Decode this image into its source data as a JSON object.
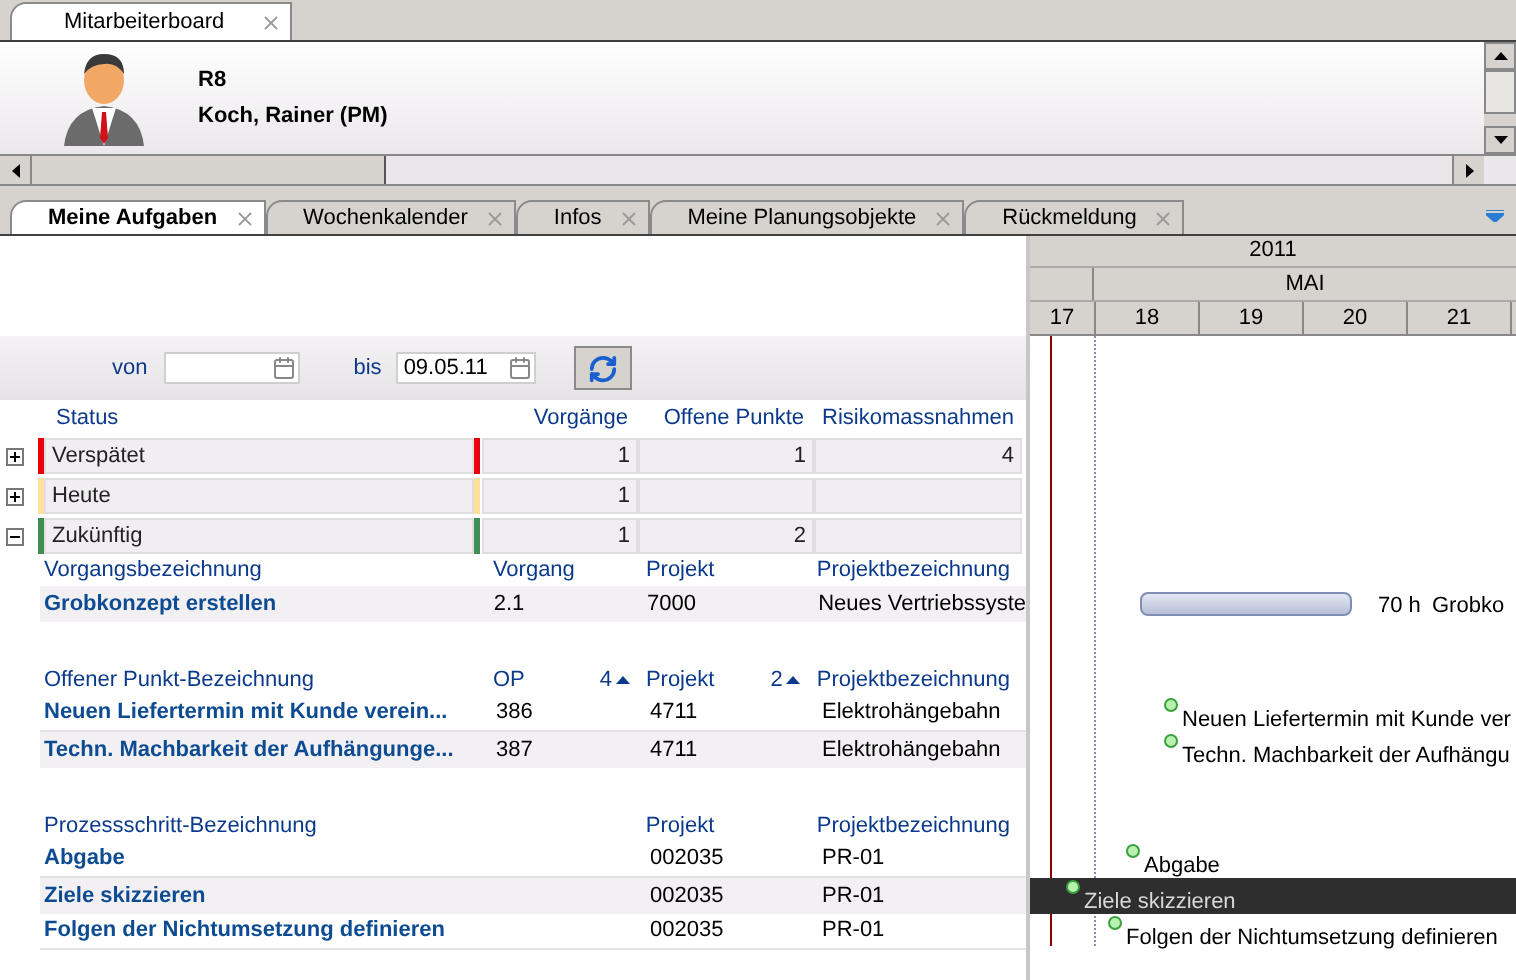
{
  "window_tab": {
    "label": "Mitarbeiterboard"
  },
  "header": {
    "code": "R8",
    "name": "Koch, Rainer (PM)"
  },
  "tabs": [
    {
      "label": "Meine Aufgaben",
      "selected": true
    },
    {
      "label": "Wochenkalender",
      "selected": false
    },
    {
      "label": "Infos",
      "selected": false
    },
    {
      "label": "Meine Planungsobjekte",
      "selected": false
    },
    {
      "label": "Rückmeldung",
      "selected": false
    }
  ],
  "filter": {
    "from_label": "von",
    "to_label": "bis",
    "to_value": "09.05.11"
  },
  "status_table": {
    "columns": [
      "Status",
      "Vorgänge",
      "Offene Punkte",
      "Risikomassnahmen"
    ],
    "rows": [
      {
        "label": "Verspätet",
        "color": "#e8000b",
        "expanded": false,
        "vorgaenge": "1",
        "offene_punkte": "1",
        "risikomassnahmen": "4"
      },
      {
        "label": "Heute",
        "color": "#fbe19a",
        "expanded": false,
        "vorgaenge": "1"
      },
      {
        "label": "Zukünftig",
        "color": "#3f8f54",
        "expanded": true,
        "vorgaenge": "1",
        "offene_punkte": "2"
      }
    ]
  },
  "tasks": {
    "columns": [
      {
        "kind": "name",
        "label": "Vorgangsbezeichnung"
      },
      {
        "kind": "number",
        "label": "Vorgang"
      },
      {
        "kind": "project",
        "label": "Projekt"
      },
      {
        "kind": "project_name",
        "label": "Projektbezeichnung"
      }
    ],
    "rows": [
      {
        "cells": [
          "Grobkonzept erstellen",
          "2.1",
          "7000",
          "Neues Vertriebssyste"
        ],
        "timeline": {
          "kind": "bar",
          "duration": "70 h",
          "label": "Grobko",
          "selected": false
        }
      }
    ]
  },
  "open_points": {
    "columns": [
      {
        "kind": "name",
        "label": "Offener Punkt-Bezeichnung"
      },
      {
        "kind": "number",
        "label": "OP",
        "sort_rank": "4",
        "sort_ascending": true
      },
      {
        "kind": "project",
        "label": "Projekt",
        "sort_rank": "2",
        "sort_ascending": true
      },
      {
        "kind": "project_name",
        "label": "Projektbezeichnung"
      }
    ],
    "rows": [
      {
        "cells": [
          "Neuen Liefertermin mit Kunde verein...",
          "386",
          "4711",
          "Elektrohängebahn"
        ],
        "timeline": {
          "kind": "milestone",
          "label": "Neuen Liefertermin mit Kunde ver",
          "selected": false
        }
      },
      {
        "cells": [
          "Techn. Machbarkeit der Aufhängunge...",
          "387",
          "4711",
          "Elektrohängebahn"
        ],
        "timeline": {
          "kind": "milestone",
          "label": "Techn. Machbarkeit der Aufhängu",
          "selected": false
        }
      }
    ]
  },
  "process_steps": {
    "columns": [
      {
        "kind": "long_name",
        "label": "Prozessschritt-Bezeichnung"
      },
      {
        "kind": "project",
        "label": "Projekt"
      },
      {
        "kind": "project_name",
        "label": "Projektbezeichnung"
      }
    ],
    "rows": [
      {
        "cells": [
          "Abgabe",
          "002035",
          "PR-01"
        ],
        "timeline": {
          "kind": "milestone",
          "label": "Abgabe",
          "selected": false
        }
      },
      {
        "cells": [
          "Ziele skizzieren",
          "002035",
          "PR-01"
        ],
        "timeline": {
          "kind": "milestone",
          "label": "Ziele skizzieren",
          "selected": true
        }
      },
      {
        "cells": [
          "Folgen der Nichtumsetzung definieren",
          "002035",
          "PR-01"
        ],
        "timeline": {
          "kind": "milestone",
          "label": "Folgen der Nichtumsetzung definieren",
          "selected": false
        }
      }
    ]
  },
  "gantt": {
    "year": "2011",
    "month": "MAI",
    "days": [
      "17",
      "18",
      "19",
      "20",
      "21"
    ]
  }
}
